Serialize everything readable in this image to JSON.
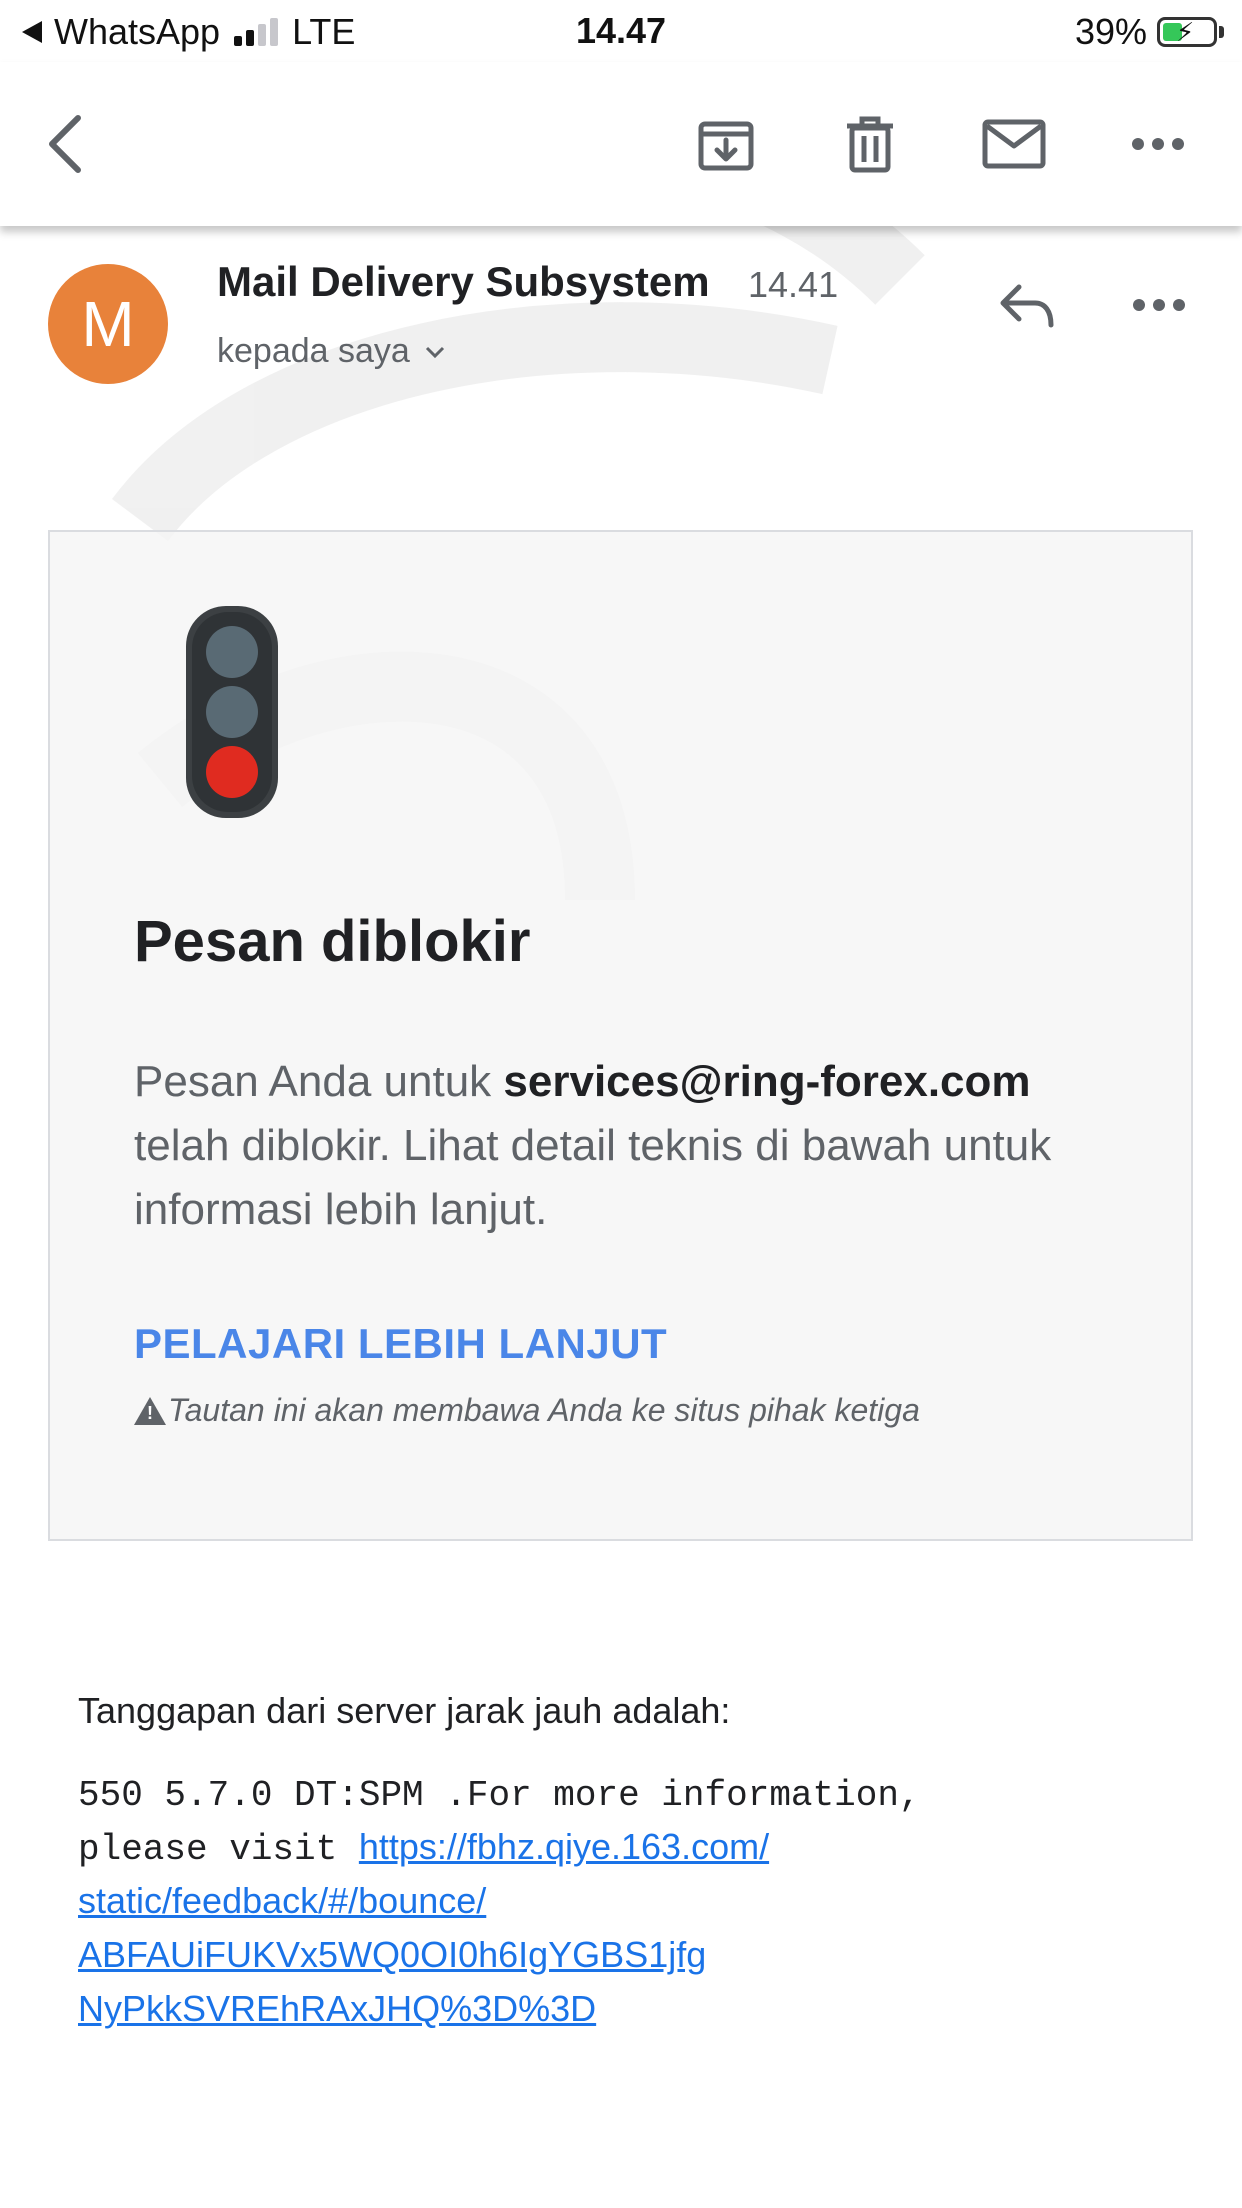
{
  "status_bar": {
    "back_app": "WhatsApp",
    "network": "LTE",
    "time": "14.47",
    "battery_percent": "39%",
    "battery_level": 0.39
  },
  "toolbar": {
    "icons": [
      "back-icon",
      "archive-icon",
      "delete-icon",
      "mark-unread-icon",
      "more-icon"
    ]
  },
  "email": {
    "avatar_letter": "M",
    "avatar_color": "#e8823a",
    "sender": "Mail Delivery Subsystem",
    "time": "14.41",
    "recipient": "kepada saya"
  },
  "card": {
    "title": "Pesan diblokir",
    "body_prefix": "Pesan Anda untuk ",
    "body_email": "services@ring-forex.com",
    "body_suffix": " telah diblokir. Lihat detail teknis di bawah untuk informasi lebih lanjut.",
    "learn_more": "PELAJARI LEBIH LANJUT",
    "warning": "Tautan ini akan membawa Anda ke situs pihak ketiga",
    "link_color": "#4a86e8"
  },
  "response": {
    "label": "Tanggapan dari server jarak jauh adalah:",
    "code_line1": "550 5.7.0 DT:SPM .For more information,",
    "code_line2_prefix": "please visit ",
    "url_lines": [
      "https://fbhz.qiye.163.com/",
      "static/feedback/#/bounce/",
      "ABFAUiFUKVx5WQ0OI0h6IgYGBS1jfg",
      "NyPkkSVREhRAxJHQ%3D%3D"
    ]
  }
}
